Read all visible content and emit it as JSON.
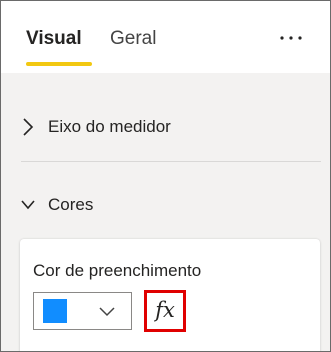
{
  "tabs": [
    {
      "label": "Visual",
      "selected": true
    },
    {
      "label": "Geral",
      "selected": false
    }
  ],
  "more_options_icon": "ellipsis-icon",
  "sections": [
    {
      "label": "Eixo do medidor",
      "expanded": false,
      "icon": "chevron-right-icon"
    },
    {
      "label": "Cores",
      "expanded": true,
      "icon": "chevron-down-icon"
    }
  ],
  "fill_color": {
    "label": "Cor de preenchimento",
    "swatch_color": "#118dff",
    "dropdown_icon": "chevron-down-icon",
    "fx_label": "fx",
    "fx_highlight_color": "#e00000"
  },
  "colors": {
    "accent": "#f2c811"
  }
}
